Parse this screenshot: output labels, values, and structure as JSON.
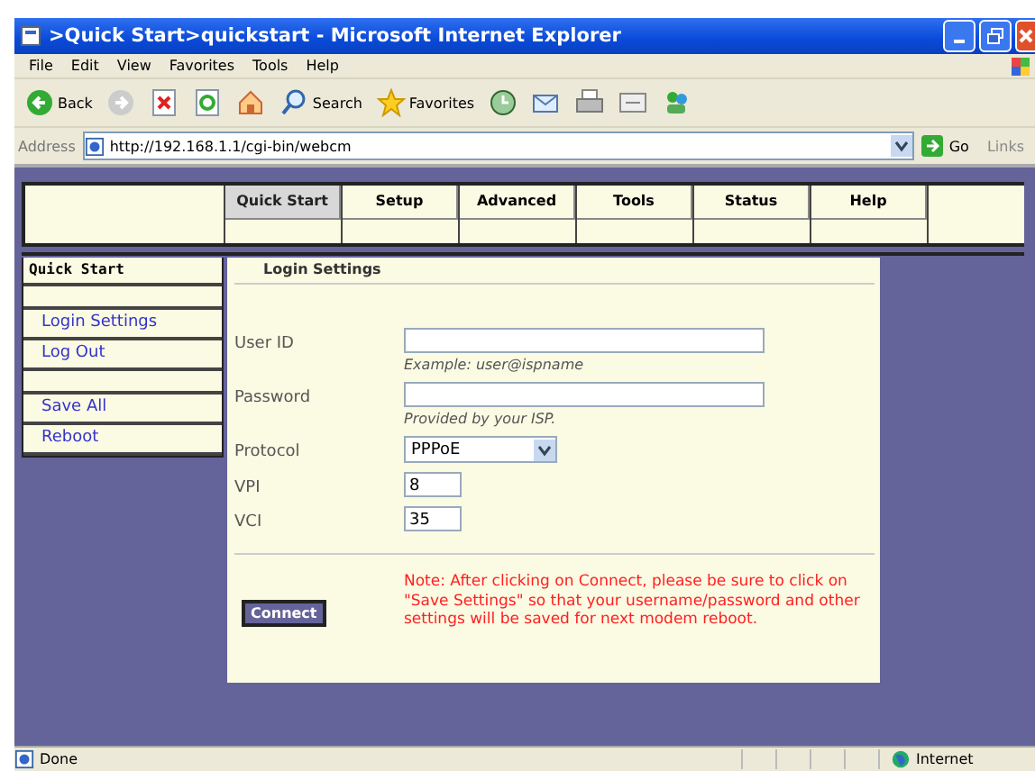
{
  "window": {
    "title": ">Quick Start>quickstart - Microsoft Internet Explorer"
  },
  "menu": [
    "File",
    "Edit",
    "View",
    "Favorites",
    "Tools",
    "Help"
  ],
  "toolbar": [
    {
      "kind": "back",
      "label": "Back"
    },
    {
      "kind": "forward"
    },
    {
      "kind": "stop"
    },
    {
      "kind": "refresh"
    },
    {
      "kind": "home"
    },
    {
      "kind": "search",
      "label": "Search"
    },
    {
      "kind": "favorites",
      "label": "Favorites"
    },
    {
      "kind": "history"
    },
    {
      "kind": "mail"
    },
    {
      "kind": "print"
    },
    {
      "kind": "edit"
    },
    {
      "kind": "messenger"
    }
  ],
  "address": {
    "label": "Address",
    "url": "http://192.168.1.1/cgi-bin/webcm",
    "go": "Go",
    "links": "Links"
  },
  "nav_tabs": [
    {
      "label": "Quick Start",
      "selected": true
    },
    {
      "label": "Setup",
      "selected": false
    },
    {
      "label": "Advanced",
      "selected": false
    },
    {
      "label": "Tools",
      "selected": false
    },
    {
      "label": "Status",
      "selected": false
    },
    {
      "label": "Help",
      "selected": false
    }
  ],
  "sidebar": {
    "heading": "Quick Start",
    "groups": [
      [
        "Login Settings",
        "Log Out"
      ],
      [
        "Save All",
        "Reboot"
      ]
    ]
  },
  "panel": {
    "title": "Login Settings",
    "fields": [
      {
        "kind": "wide",
        "label": "User ID",
        "hint": "Example: user@ispname"
      },
      {
        "kind": "wide",
        "label": "Password",
        "hint": "Provided by your ISP."
      },
      {
        "kind": "select",
        "label": "Protocol",
        "value": "PPPoE"
      },
      {
        "kind": "short",
        "label": "VPI",
        "value": "8"
      },
      {
        "kind": "short",
        "label": "VCI",
        "value": "35"
      }
    ],
    "button": "Connect",
    "note": "Note: After clicking on Connect, please be sure to click on \"Save Settings\" so that your username/password and other settings will be saved for next modem reboot."
  },
  "status_bar": {
    "text": "Done",
    "zone": "Internet"
  }
}
